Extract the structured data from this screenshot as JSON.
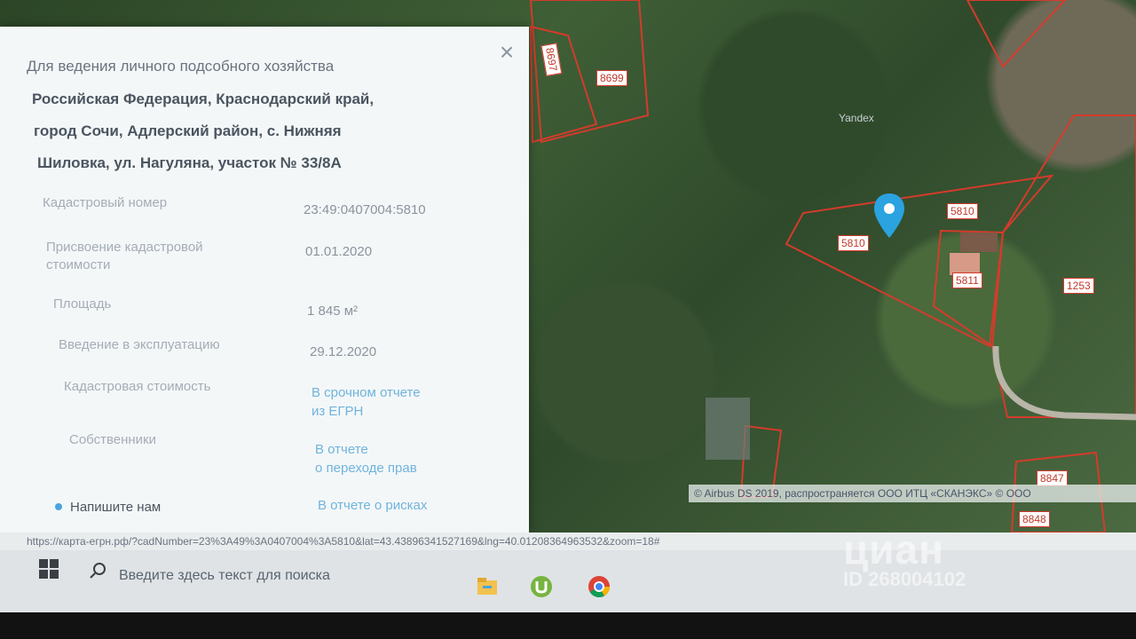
{
  "map": {
    "plots": [
      "8697",
      "8699",
      "5810",
      "5810",
      "5811",
      "1253",
      "8847",
      "8848"
    ],
    "watermark_text": "Yandex",
    "attribution": "© Airbus DS 2019, распространяется ООО ИТЦ «СКАНЭКС» © ООО",
    "pin_color": "#2aa3e0",
    "boundary_color": "#d43b2b"
  },
  "card": {
    "title": "Для ведения личного подсобного хозяйства",
    "address_lines": [
      "Российская Федерация, Краснодарский край,",
      "город Сочи, Адлерский район, с. Нижняя",
      "Шиловка, ул. Нагуляна, участок № 33/8А"
    ],
    "rows": [
      {
        "label": "Кадастровый номер",
        "value": "23:49:0407004:5810"
      },
      {
        "label": "Присвоение кадастровой",
        "label2": "стоимости",
        "value": "01.01.2020"
      },
      {
        "label": "Площадь",
        "value": "1 845 м²"
      },
      {
        "label": "Введение в эксплуатацию",
        "value": "29.12.2020"
      },
      {
        "label": "Кадастровая стоимость",
        "value": "В срочном отчете",
        "value2": "из ЕГРН"
      },
      {
        "label": "Собственники",
        "value": "В отчете",
        "value2": "о переходе прав"
      },
      {
        "label": "",
        "value": "В отчете о рисках"
      }
    ],
    "chat_label": "Напишите нам",
    "close_icon": "close-icon"
  },
  "url": "https://карта-егрн.рф/?cadNumber=23%3A49%3A0407004%3A5810&lat=43.438963415271​69&lng=40.01208364963532&zoom=18#",
  "taskbar": {
    "search_placeholder": "Введите здесь текст для поиска",
    "apps": [
      "file-explorer-icon",
      "utorrent-icon",
      "chrome-icon"
    ]
  },
  "watermark": {
    "logo": "циан",
    "id": "ID 268004102"
  }
}
